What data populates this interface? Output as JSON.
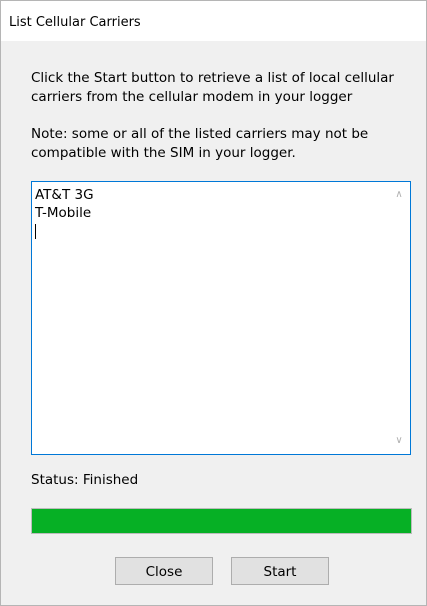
{
  "window": {
    "title": "List Cellular Carriers"
  },
  "instructions": {
    "line1": "Click the Start button to retrieve a list of local cellular carriers from the cellular modem in your logger",
    "line2": "Note: some or all of the listed carriers may not be compatible with the SIM in your logger."
  },
  "carriers": {
    "items": [
      "AT&T 3G",
      "T-Mobile"
    ]
  },
  "scrollbar": {
    "up_icon": "chevron-up-icon",
    "down_icon": "chevron-down-icon"
  },
  "status": {
    "text": "Status: Finished"
  },
  "progress": {
    "percent": 100,
    "color": "#06b025"
  },
  "buttons": {
    "close_label": "Close",
    "start_label": "Start"
  }
}
